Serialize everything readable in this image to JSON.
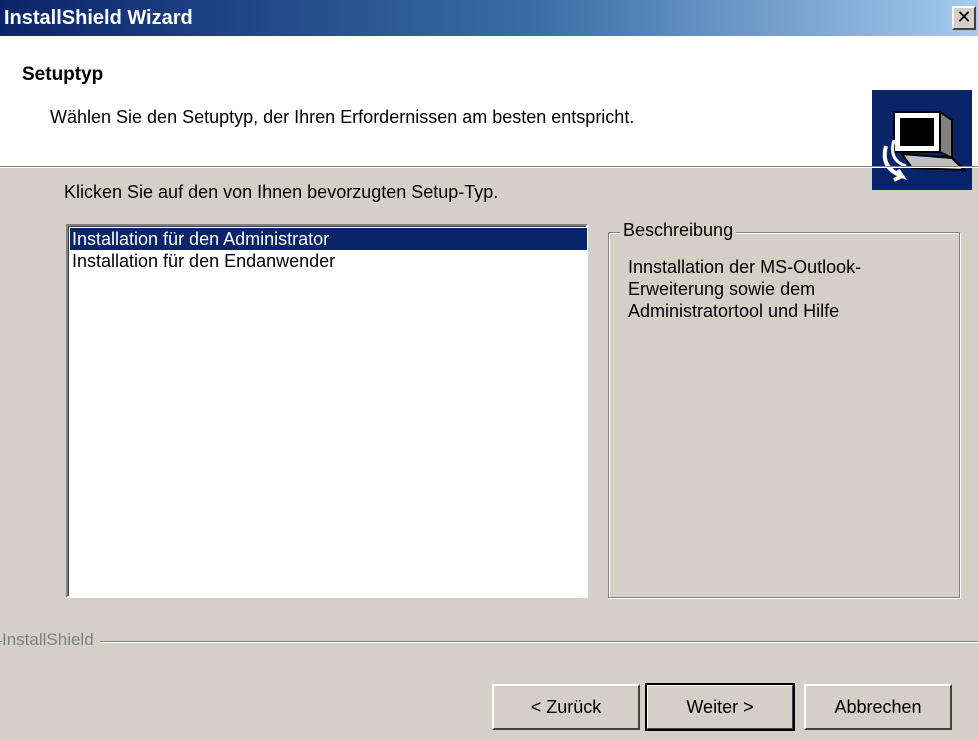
{
  "window": {
    "title": "InstallShield Wizard",
    "close_label": "✕"
  },
  "header": {
    "title": "Setuptyp",
    "subtitle": "Wählen Sie den Setuptyp, der Ihren Erfordernissen am besten entspricht."
  },
  "main": {
    "instruction": "Klicken Sie auf den von Ihnen bevorzugten Setup-Typ.",
    "setup_types": [
      {
        "label": "Installation für den Administrator",
        "selected": true
      },
      {
        "label": "Installation für den Endanwender",
        "selected": false
      }
    ],
    "description": {
      "legend": "Beschreibung",
      "text": "Innstallation der MS-Outlook-Erweiterung sowie dem Administratortool und Hilfe"
    }
  },
  "footer": {
    "brand": "InstallShield",
    "back_label": "< Zurück",
    "next_label": "Weiter >",
    "cancel_label": "Abbrechen"
  },
  "colors": {
    "title_bar_start": "#0a246a",
    "title_bar_end": "#a6caf0",
    "selection": "#0a246a",
    "dialog_face": "#d4d0c8"
  }
}
